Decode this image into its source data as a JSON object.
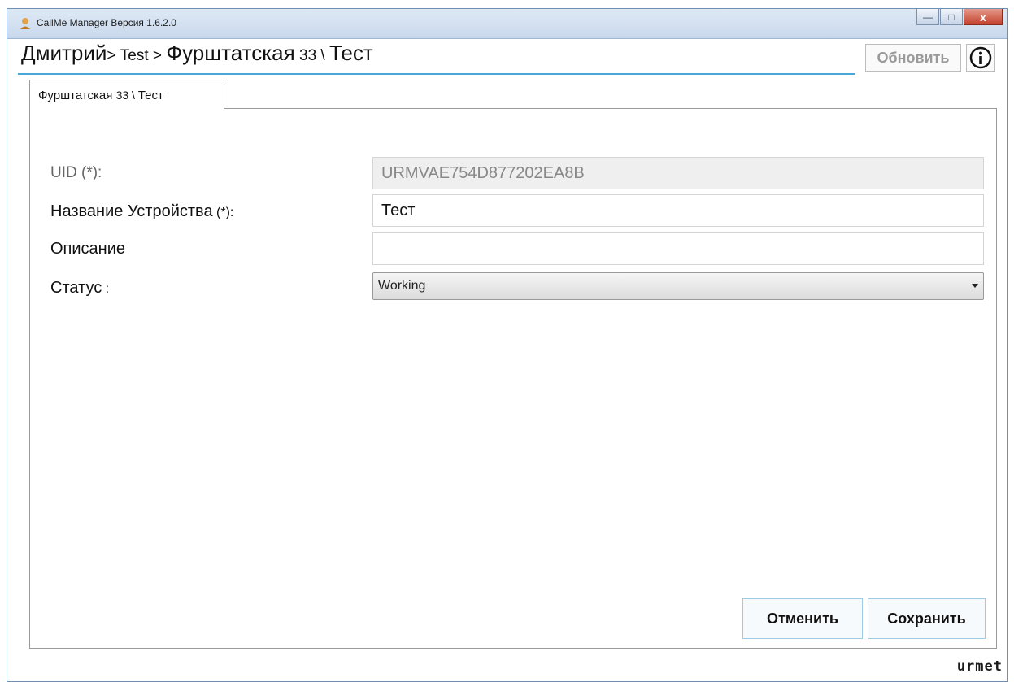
{
  "window": {
    "title": "CallMe Manager Версия 1.6.2.0",
    "close_label": "x",
    "minimize_label": "—",
    "maximize_label": "□"
  },
  "header": {
    "breadcrumb_user": "Дмитрий",
    "breadcrumb_sep1": "> ",
    "breadcrumb_group": "Test",
    "breadcrumb_sep2": " > ",
    "breadcrumb_location": "Фурштатская",
    "breadcrumb_number": " 33 \\ ",
    "breadcrumb_device": "Тест",
    "refresh_label": "Обновить",
    "info_label": "i"
  },
  "tab": {
    "label_main": "Фурштатская ",
    "label_num": "33 \\ ",
    "label_device": "Тест"
  },
  "form": {
    "uid_label": "UID (*):",
    "uid_value": "URMVAE754D877202EA8B",
    "name_label": "Название Устройства",
    "name_suffix": " (*):",
    "name_value": "Тест",
    "description_label": "Описание",
    "description_value": "",
    "status_label": "Статус",
    "status_colon": " :",
    "status_value": "Working"
  },
  "buttons": {
    "cancel_label": "Отменить",
    "save_label": "Сохранить"
  },
  "footer": {
    "logo_text": "urmet"
  }
}
